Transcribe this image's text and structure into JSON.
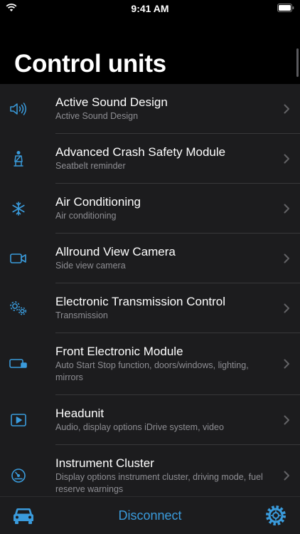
{
  "status_bar": {
    "time": "9:41 AM"
  },
  "page": {
    "title": "Control units"
  },
  "colors": {
    "accent": "#3a9bdc",
    "background": "#000000",
    "list_bg": "#1c1c1e",
    "subtitle": "#8e8e93"
  },
  "items": [
    {
      "title": "Active Sound Design",
      "subtitle": "Active Sound Design",
      "icon": "speaker-icon"
    },
    {
      "title": "Advanced Crash Safety Module",
      "subtitle": "Seatbelt reminder",
      "icon": "seatbelt-icon"
    },
    {
      "title": "Air Conditioning",
      "subtitle": "Air conditioning",
      "icon": "snowflake-icon"
    },
    {
      "title": "Allround View Camera",
      "subtitle": "Side view camera",
      "icon": "video-camera-icon"
    },
    {
      "title": "Electronic Transmission Control",
      "subtitle": "Transmission",
      "icon": "gears-icon"
    },
    {
      "title": "Front Electronic Module",
      "subtitle": "Auto Start Stop function, doors/windows, lighting, mirrors",
      "icon": "module-icon"
    },
    {
      "title": "Headunit",
      "subtitle": "Audio, display options iDrive system, video",
      "icon": "play-screen-icon"
    },
    {
      "title": "Instrument Cluster",
      "subtitle": "Display options instrument cluster, driving mode, fuel reserve warnings",
      "icon": "gauge-icon"
    }
  ],
  "tab_bar": {
    "disconnect_label": "Disconnect",
    "left_icon": "car-icon",
    "right_icon": "gear-icon"
  }
}
